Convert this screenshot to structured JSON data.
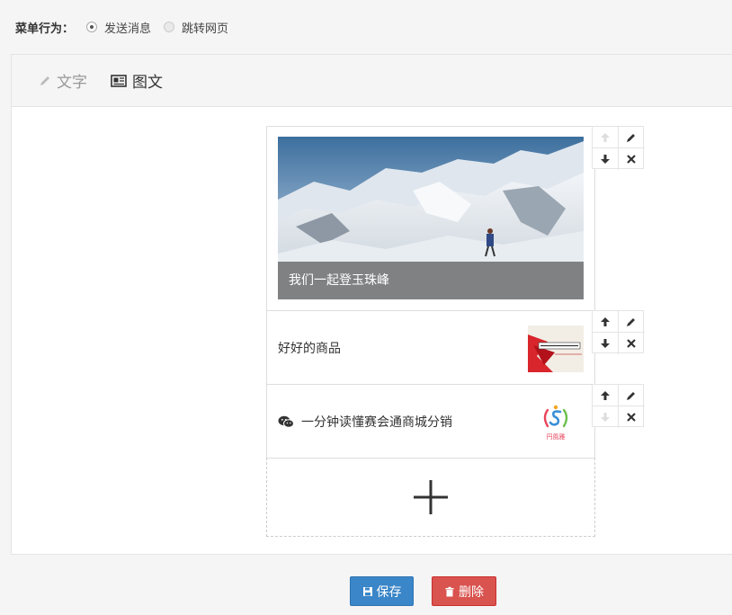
{
  "menu_action": {
    "label": "菜单行为：",
    "options": [
      {
        "label": "发送消息",
        "selected": true
      },
      {
        "label": "跳转网页",
        "selected": false
      }
    ]
  },
  "tabs": [
    {
      "label": "文字",
      "icon": "pencil-icon",
      "active": false
    },
    {
      "label": "图文",
      "icon": "newspaper-icon",
      "active": true
    }
  ],
  "articles": [
    {
      "title": "我们一起登玉珠峰",
      "image": "snow-mountain-climber"
    },
    {
      "title": "好好的商品",
      "image": "running-poster"
    },
    {
      "title": "一分钟读懂赛会通商城分销",
      "image": "logo-thumbnail",
      "thumb_caption": "円風雅",
      "has_wechat_icon": true
    }
  ],
  "add_label": "+",
  "footer": {
    "save_label": "保存",
    "delete_label": "删除"
  },
  "colors": {
    "save": "#3a86c8",
    "delete": "#d9534f"
  }
}
